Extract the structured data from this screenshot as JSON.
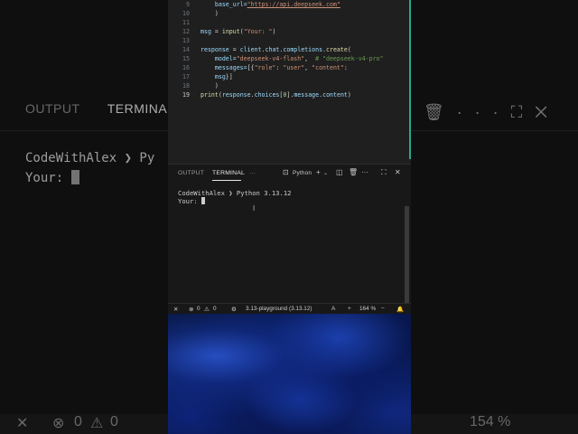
{
  "background": {
    "tabs": [
      "OUTPUT",
      "TERMINA"
    ],
    "terminal_line1": "CodeWithAlex ❯ Py",
    "terminal_line2": "Your: ",
    "status_left": "0",
    "status_mid": "0",
    "status_zoom": "154 %"
  },
  "editor": {
    "lines": [
      {
        "n": "9",
        "code": [
          {
            "t": "    base_url=",
            "c": "var"
          },
          {
            "t": "\"https://api.deepseek.com\"",
            "c": "url"
          }
        ]
      },
      {
        "n": "10",
        "code": [
          {
            "t": "    )",
            "c": ""
          }
        ]
      },
      {
        "n": "11",
        "code": []
      },
      {
        "n": "12",
        "code": [
          {
            "t": "msg",
            "c": "var"
          },
          {
            "t": " = ",
            "c": ""
          },
          {
            "t": "input",
            "c": "fn"
          },
          {
            "t": "(",
            "c": ""
          },
          {
            "t": "\"Your: \"",
            "c": "str"
          },
          {
            "t": ")",
            "c": ""
          }
        ]
      },
      {
        "n": "13",
        "code": []
      },
      {
        "n": "14",
        "code": [
          {
            "t": "response",
            "c": "var"
          },
          {
            "t": " = ",
            "c": ""
          },
          {
            "t": "client",
            "c": "var"
          },
          {
            "t": ".",
            "c": ""
          },
          {
            "t": "chat",
            "c": "var"
          },
          {
            "t": ".",
            "c": ""
          },
          {
            "t": "completions",
            "c": "var"
          },
          {
            "t": ".",
            "c": ""
          },
          {
            "t": "create",
            "c": "fn"
          },
          {
            "t": "(",
            "c": ""
          }
        ]
      },
      {
        "n": "15",
        "code": [
          {
            "t": "    model=",
            "c": "var"
          },
          {
            "t": "\"deepseek-v4-flash\"",
            "c": "str"
          },
          {
            "t": ",  ",
            "c": ""
          },
          {
            "t": "# \"deepseek-v4-pro\"",
            "c": "cm"
          }
        ]
      },
      {
        "n": "16",
        "code": [
          {
            "t": "    messages=",
            "c": "var"
          },
          {
            "t": "[{",
            "c": ""
          },
          {
            "t": "\"role\"",
            "c": "str"
          },
          {
            "t": ": ",
            "c": ""
          },
          {
            "t": "\"user\"",
            "c": "str"
          },
          {
            "t": ", ",
            "c": ""
          },
          {
            "t": "\"content\"",
            "c": "str"
          },
          {
            "t": ":",
            "c": ""
          }
        ]
      },
      {
        "n": "17",
        "code": [
          {
            "t": "    msg",
            "c": "var"
          },
          {
            "t": "}]",
            "c": ""
          }
        ]
      },
      {
        "n": "18",
        "code": [
          {
            "t": "    )",
            "c": ""
          }
        ]
      },
      {
        "n": "19",
        "code": [
          {
            "t": "print",
            "c": "fn"
          },
          {
            "t": "(",
            "c": ""
          },
          {
            "t": "response",
            "c": "var"
          },
          {
            "t": ".",
            "c": ""
          },
          {
            "t": "choices",
            "c": "var"
          },
          {
            "t": "[",
            "c": ""
          },
          {
            "t": "0",
            "c": "num"
          },
          {
            "t": "].",
            "c": ""
          },
          {
            "t": "message",
            "c": "var"
          },
          {
            "t": ".",
            "c": ""
          },
          {
            "t": "content",
            "c": "var"
          },
          {
            "t": ")",
            "c": ""
          }
        ],
        "current": true
      }
    ]
  },
  "panel": {
    "tab_output": "OUTPUT",
    "tab_terminal": "TERMINAL",
    "tab_more": "···",
    "shell": "Python",
    "terminal_prompt": "CodeWithAlex ❯ Python 3.13.12",
    "terminal_input": "Your: "
  },
  "status": {
    "errors": "0",
    "warnings": "0",
    "interpreter": "3.13-playground (3.13.12)",
    "zoom": "164 %"
  },
  "colors": {
    "accent": "#2aa889",
    "editor_bg": "#1f1f1f",
    "panel_bg": "#181818"
  }
}
